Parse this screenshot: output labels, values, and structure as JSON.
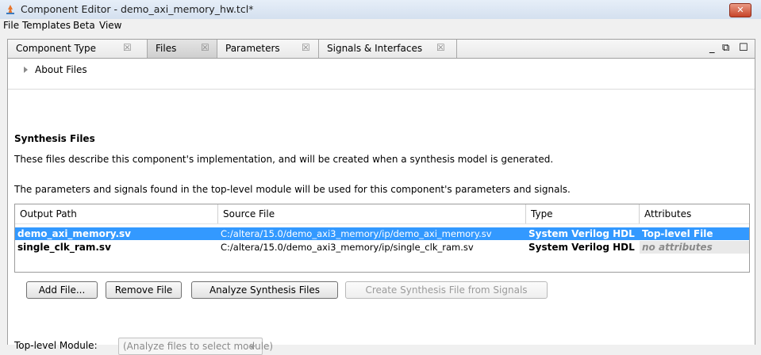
{
  "window": {
    "title": "Component Editor - demo_axi_memory_hw.tcl*",
    "close_symbol": "✕",
    "icon": "quartus-app-icon"
  },
  "menu": [
    "File",
    "Templates",
    "Beta",
    "View"
  ],
  "tabs": [
    {
      "label": "Component Type",
      "close": "☒"
    },
    {
      "label": "Files",
      "close": "☒",
      "active": true
    },
    {
      "label": "Parameters",
      "close": "☒"
    },
    {
      "label": "Signals & Interfaces",
      "close": "☒"
    }
  ],
  "panel_controls": {
    "minimize": "_",
    "restore": "⧉",
    "maximize": "☐"
  },
  "about": {
    "label": "About Files"
  },
  "synthesis": {
    "title": "Synthesis Files",
    "desc1": "These files describe this component's implementation, and will be created when a synthesis model is generated.",
    "desc2": "The parameters and signals found in the top-level module will be used for this component's parameters and signals."
  },
  "table": {
    "headers": [
      "Output Path",
      "Source File",
      "Type",
      "Attributes"
    ],
    "rows": [
      {
        "output": "demo_axi_memory.sv",
        "source": "C:/altera/15.0/demo_axi3_memory/ip/demo_axi_memory.sv",
        "type": "System Verilog HDL",
        "attributes": "Top-level File",
        "selected": true
      },
      {
        "output": "single_clk_ram.sv",
        "source": "C:/altera/15.0/demo_axi3_memory/ip/single_clk_ram.sv",
        "type": "System Verilog HDL",
        "attributes": "no attributes",
        "selected": false
      }
    ]
  },
  "buttons": {
    "add": "Add File...",
    "remove": "Remove File",
    "analyze": "Analyze Synthesis Files",
    "create": "Create Synthesis File from Signals"
  },
  "toplevel": {
    "label": "Top-level Module:",
    "value": "(Analyze files to select module)"
  },
  "colors": {
    "selection": "#3399ff",
    "close_button": "#c7442a"
  }
}
